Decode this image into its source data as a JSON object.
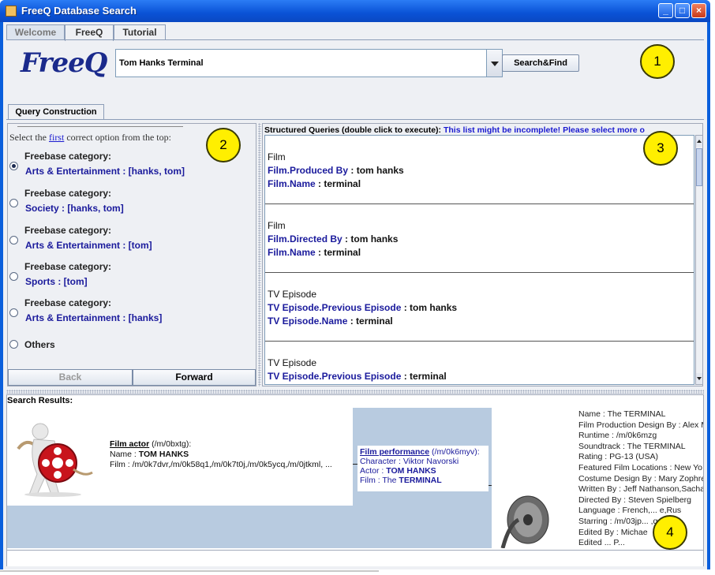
{
  "window": {
    "title": "FreeQ Database Search"
  },
  "tabs": [
    "Welcome",
    "FreeQ",
    "Tutorial"
  ],
  "logo_text": "FreeQ",
  "search": {
    "value": "Tom Hanks Terminal",
    "button_label": "Search&Find"
  },
  "annotations": [
    "1",
    "2",
    "3",
    "4"
  ],
  "query_construction": {
    "tab_label": "Query Construction",
    "hint_prefix": "Select the ",
    "hint_link": "first",
    "hint_suffix": " correct option from the top:",
    "options": [
      {
        "category": "Freebase category:",
        "value": "Arts & Entertainment : [hanks, tom]",
        "selected": true
      },
      {
        "category": "Freebase category:",
        "value": "Society : [hanks, tom]",
        "selected": false
      },
      {
        "category": "Freebase category:",
        "value": "Arts & Entertainment : [tom]",
        "selected": false
      },
      {
        "category": "Freebase category:",
        "value": "Sports : [tom]",
        "selected": false
      },
      {
        "category": "Freebase category:",
        "value": "Arts & Entertainment : [hanks]",
        "selected": false
      }
    ],
    "others_label": "Others",
    "back_label": "Back",
    "forward_label": "Forward"
  },
  "structured_queries": {
    "header": "Structured Queries (double click to execute):",
    "warning": "This list might be incomplete! Please select more o",
    "items": [
      {
        "type": "Film",
        "lines": [
          {
            "key": "Film.Produced By",
            "val": " : tom hanks"
          },
          {
            "key": "Film.Name",
            "val": " : terminal"
          }
        ]
      },
      {
        "type": "Film",
        "lines": [
          {
            "key": "Film.Directed By",
            "val": " : tom hanks"
          },
          {
            "key": "Film.Name",
            "val": " : terminal"
          }
        ]
      },
      {
        "type": "TV Episode",
        "lines": [
          {
            "key": "TV Episode.Previous Episode",
            "val": " : tom hanks"
          },
          {
            "key": "TV Episode.Name",
            "val": " : terminal"
          }
        ]
      },
      {
        "type": "TV Episode",
        "lines": [
          {
            "key": "TV Episode.Previous Episode",
            "val": " : terminal"
          }
        ]
      }
    ]
  },
  "results": {
    "label": "Search Results:",
    "actor": {
      "link": "Film actor",
      "id": " (/m/0bxtg):",
      "name_label": "Name : ",
      "name": "TOM HANKS",
      "films": "Film : /m/0k7dvr,/m/0k58q1,/m/0k7t0j,/m/0k5ycq,/m/0jtkml, ..."
    },
    "performance": {
      "link": "Film performance",
      "id": " (/m/0k6myv):",
      "character": "Character : Viktor Navorski",
      "actor_label": "Actor : ",
      "actor": "TOM HANKS",
      "film_label": "Film : The ",
      "film": "TERMINAL"
    },
    "film_details": [
      "Name : The TERMINAL",
      "Film Production Design By : Alex M",
      "Runtime : /m/0k6mzg",
      "Soundtrack : The TERMINAL",
      "Rating : PG-13 (USA)",
      "Featured Film Locations : New Yo",
      "Costume Design By : Mary Zophre",
      "Written By : Jeff Nathanson,Sacha",
      "Directed By : Steven Spielberg",
      "Language : French,... e,Rus",
      "Starring : /m/03jp... ,q4",
      "Edited By : Michae",
      "Edited ... P..."
    ]
  }
}
